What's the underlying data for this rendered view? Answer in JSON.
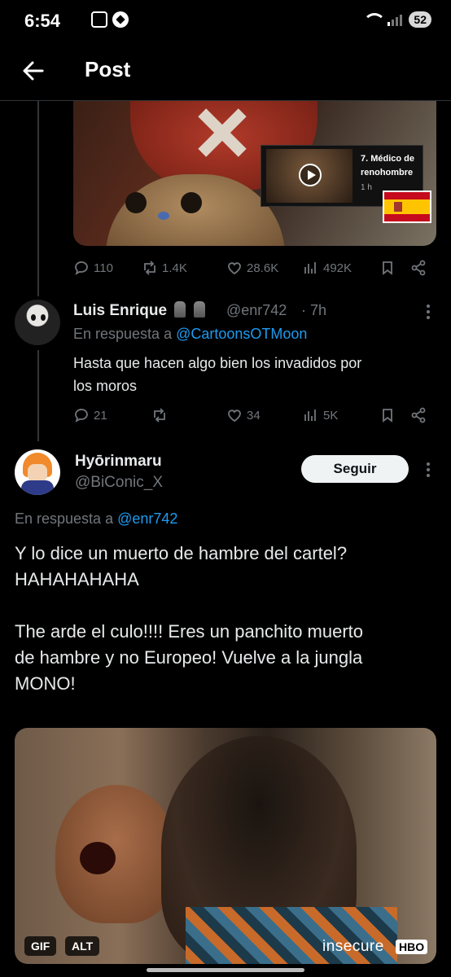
{
  "status_bar": {
    "time": "6:54",
    "battery": "52"
  },
  "header": {
    "title": "Post"
  },
  "original_post": {
    "video_card": {
      "title": "7. Médico de renohombre",
      "time": "1 h"
    },
    "actions": {
      "replies": "110",
      "reposts": "1.4K",
      "likes": "28.6K",
      "views": "492K"
    }
  },
  "reply1": {
    "name": "Luis Enrique",
    "handle": "@enr742",
    "time": "· 7h",
    "reply_prefix": "En respuesta a",
    "reply_to": "@CartoonsOTMoon",
    "text": "Hasta que hacen algo bien los invadidos por\nlos moros",
    "actions": {
      "replies": "21",
      "reposts": "",
      "likes": "34",
      "views": "5K"
    }
  },
  "reply2": {
    "name": "Hyōrinmaru",
    "handle": "@BiConic_X",
    "follow_label": "Seguir",
    "reply_prefix": "En respuesta a",
    "reply_to": "@enr742",
    "text": "Y lo dice un muerto de hambre del cartel?\nHAHAHAHAHA\n\nThe arde el culo!!!! Eres un panchito muerto\nde hambre y no Europeo! Vuelve a la jungla\nMONO!",
    "media": {
      "gif_badge": "GIF",
      "alt_badge": "ALT",
      "watermark": "insecure",
      "network": "HBO"
    }
  },
  "colors": {
    "background": "#000000",
    "link": "#1d9bf0",
    "muted": "#71767b",
    "text": "#e7e9ea"
  }
}
